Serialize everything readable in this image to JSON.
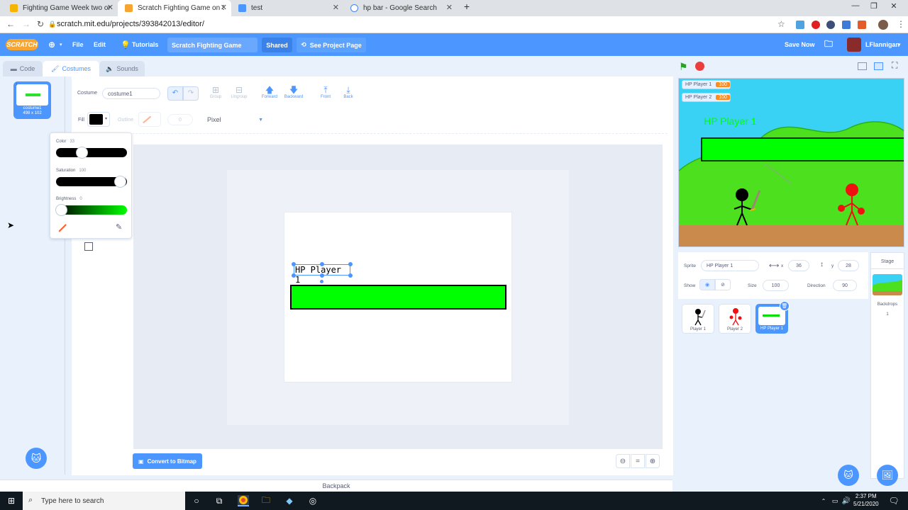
{
  "browser": {
    "tabs": [
      {
        "label": "Fighting Game Week two on Scr",
        "color": "#f4b400"
      },
      {
        "label": "Scratch Fighting Game on Scrat",
        "color": "#f7a531"
      },
      {
        "label": "test",
        "color": "#4c97ff"
      },
      {
        "label": "hp bar - Google Search",
        "color": "#4285f4"
      }
    ],
    "url": "scratch.mit.edu/projects/393842013/editor/"
  },
  "menu": {
    "logo": "SCRATCH",
    "file": "File",
    "edit": "Edit",
    "tutorials": "Tutorials",
    "project_title": "Scratch Fighting Game",
    "shared": "Shared",
    "see_project": "See Project Page",
    "save_now": "Save Now",
    "username": "LFlannigan"
  },
  "editor_tabs": {
    "code": "Code",
    "costumes": "Costumes",
    "sounds": "Sounds"
  },
  "costume_list": [
    {
      "num": "1",
      "name": "costume1",
      "size": "498 x 102"
    }
  ],
  "paint": {
    "costume_label": "Costume",
    "costume_name": "costume1",
    "tools": {
      "group": "Group",
      "ungroup": "Ungroup",
      "forward": "Forward",
      "backward": "Backward",
      "front": "Front",
      "back": "Back"
    },
    "fill_label": "Fill",
    "outline_label": "Outline",
    "outline_width": "0",
    "mode": "Pixel",
    "convert": "Convert to Bitmap",
    "text_object": "HP Player 1",
    "fill_color": "#000000",
    "bar_color": "#00ff00"
  },
  "color_popup": {
    "color_label": "Color",
    "color_value": "33",
    "saturation_label": "Saturation",
    "saturation_value": "100",
    "brightness_label": "Brightness",
    "brightness_value": "0"
  },
  "stage": {
    "monitors": [
      {
        "label": "HP Player 1",
        "value": "100"
      },
      {
        "label": "HP Player 2",
        "value": "100"
      }
    ],
    "text": "HP Player 1"
  },
  "sprite_info": {
    "sprite_label": "Sprite",
    "sprite_name": "HP Player 1",
    "x_label": "x",
    "x": "36",
    "y_label": "y",
    "y": "28",
    "show_label": "Show",
    "size_label": "Size",
    "size": "100",
    "direction_label": "Direction",
    "direction": "90"
  },
  "sprites": [
    {
      "name": "Player 1"
    },
    {
      "name": "Player 2"
    },
    {
      "name": "HP Player 1"
    }
  ],
  "stage_pane": {
    "label": "Stage",
    "backdrops_label": "Backdrops",
    "backdrops_count": "1"
  },
  "backpack": "Backpack",
  "taskbar": {
    "search_placeholder": "Type here to search",
    "time": "2:37 PM",
    "date": "5/21/2020"
  }
}
